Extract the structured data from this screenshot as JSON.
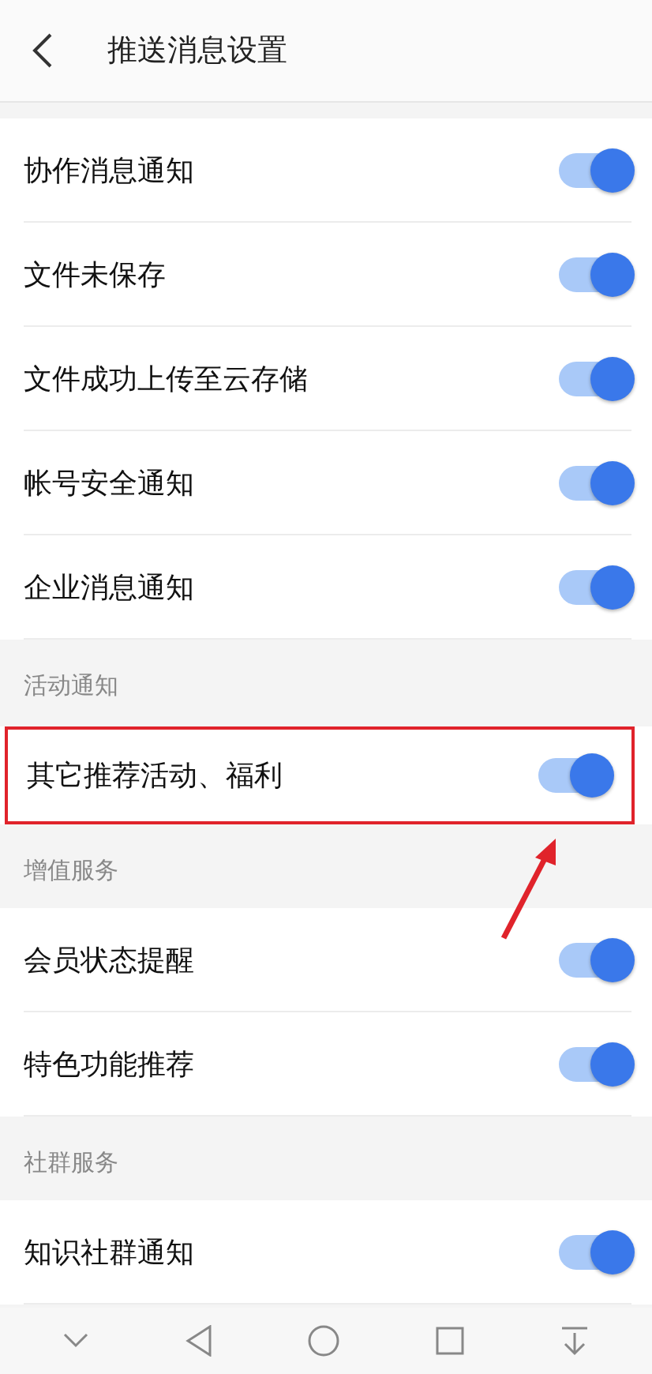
{
  "header": {
    "title": "推送消息设置"
  },
  "sections": [
    {
      "items": [
        {
          "label": "协作消息通知",
          "on": true,
          "highlighted": false
        },
        {
          "label": "文件未保存",
          "on": true,
          "highlighted": false
        },
        {
          "label": "文件成功上传至云存储",
          "on": true,
          "highlighted": false
        },
        {
          "label": "帐号安全通知",
          "on": true,
          "highlighted": false
        },
        {
          "label": "企业消息通知",
          "on": true,
          "highlighted": false
        }
      ]
    },
    {
      "title": "活动通知",
      "items": [
        {
          "label": "其它推荐活动、福利",
          "on": true,
          "highlighted": true
        }
      ]
    },
    {
      "title": "增值服务",
      "items": [
        {
          "label": "会员状态提醒",
          "on": true,
          "highlighted": false
        },
        {
          "label": "特色功能推荐",
          "on": true,
          "highlighted": false
        }
      ]
    },
    {
      "title": "社群服务",
      "items": [
        {
          "label": "知识社群通知",
          "on": true,
          "highlighted": false
        }
      ]
    }
  ]
}
